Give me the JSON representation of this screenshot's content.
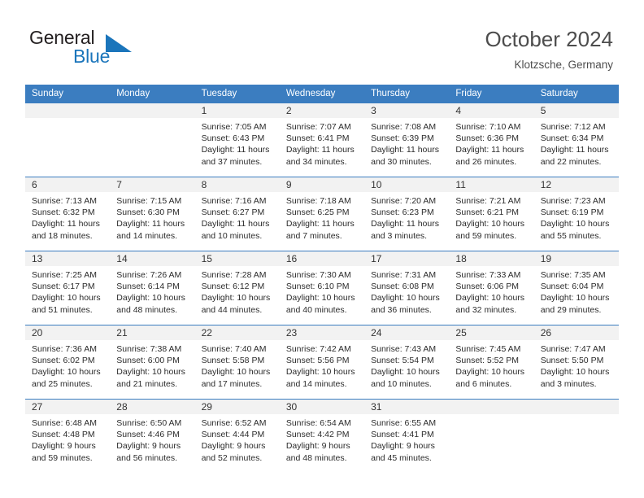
{
  "brand": {
    "name_part1": "General",
    "name_part2": "Blue",
    "flag_icon": "triangle-flag-icon",
    "accent_color": "#1b75bb"
  },
  "header": {
    "title": "October 2024",
    "subtitle": "Klotzsche, Germany"
  },
  "theme": {
    "header_row_color": "#3b7dc0",
    "daynum_band_color": "#f2f2f2",
    "text_color": "#2b2b2b"
  },
  "weekday_headers": [
    "Sunday",
    "Monday",
    "Tuesday",
    "Wednesday",
    "Thursday",
    "Friday",
    "Saturday"
  ],
  "weeks": [
    [
      {
        "day": "",
        "sunrise": "",
        "sunset": "",
        "daylight_line1": "",
        "daylight_line2": ""
      },
      {
        "day": "",
        "sunrise": "",
        "sunset": "",
        "daylight_line1": "",
        "daylight_line2": ""
      },
      {
        "day": "1",
        "sunrise": "Sunrise: 7:05 AM",
        "sunset": "Sunset: 6:43 PM",
        "daylight_line1": "Daylight: 11 hours",
        "daylight_line2": "and 37 minutes."
      },
      {
        "day": "2",
        "sunrise": "Sunrise: 7:07 AM",
        "sunset": "Sunset: 6:41 PM",
        "daylight_line1": "Daylight: 11 hours",
        "daylight_line2": "and 34 minutes."
      },
      {
        "day": "3",
        "sunrise": "Sunrise: 7:08 AM",
        "sunset": "Sunset: 6:39 PM",
        "daylight_line1": "Daylight: 11 hours",
        "daylight_line2": "and 30 minutes."
      },
      {
        "day": "4",
        "sunrise": "Sunrise: 7:10 AM",
        "sunset": "Sunset: 6:36 PM",
        "daylight_line1": "Daylight: 11 hours",
        "daylight_line2": "and 26 minutes."
      },
      {
        "day": "5",
        "sunrise": "Sunrise: 7:12 AM",
        "sunset": "Sunset: 6:34 PM",
        "daylight_line1": "Daylight: 11 hours",
        "daylight_line2": "and 22 minutes."
      }
    ],
    [
      {
        "day": "6",
        "sunrise": "Sunrise: 7:13 AM",
        "sunset": "Sunset: 6:32 PM",
        "daylight_line1": "Daylight: 11 hours",
        "daylight_line2": "and 18 minutes."
      },
      {
        "day": "7",
        "sunrise": "Sunrise: 7:15 AM",
        "sunset": "Sunset: 6:30 PM",
        "daylight_line1": "Daylight: 11 hours",
        "daylight_line2": "and 14 minutes."
      },
      {
        "day": "8",
        "sunrise": "Sunrise: 7:16 AM",
        "sunset": "Sunset: 6:27 PM",
        "daylight_line1": "Daylight: 11 hours",
        "daylight_line2": "and 10 minutes."
      },
      {
        "day": "9",
        "sunrise": "Sunrise: 7:18 AM",
        "sunset": "Sunset: 6:25 PM",
        "daylight_line1": "Daylight: 11 hours",
        "daylight_line2": "and 7 minutes."
      },
      {
        "day": "10",
        "sunrise": "Sunrise: 7:20 AM",
        "sunset": "Sunset: 6:23 PM",
        "daylight_line1": "Daylight: 11 hours",
        "daylight_line2": "and 3 minutes."
      },
      {
        "day": "11",
        "sunrise": "Sunrise: 7:21 AM",
        "sunset": "Sunset: 6:21 PM",
        "daylight_line1": "Daylight: 10 hours",
        "daylight_line2": "and 59 minutes."
      },
      {
        "day": "12",
        "sunrise": "Sunrise: 7:23 AM",
        "sunset": "Sunset: 6:19 PM",
        "daylight_line1": "Daylight: 10 hours",
        "daylight_line2": "and 55 minutes."
      }
    ],
    [
      {
        "day": "13",
        "sunrise": "Sunrise: 7:25 AM",
        "sunset": "Sunset: 6:17 PM",
        "daylight_line1": "Daylight: 10 hours",
        "daylight_line2": "and 51 minutes."
      },
      {
        "day": "14",
        "sunrise": "Sunrise: 7:26 AM",
        "sunset": "Sunset: 6:14 PM",
        "daylight_line1": "Daylight: 10 hours",
        "daylight_line2": "and 48 minutes."
      },
      {
        "day": "15",
        "sunrise": "Sunrise: 7:28 AM",
        "sunset": "Sunset: 6:12 PM",
        "daylight_line1": "Daylight: 10 hours",
        "daylight_line2": "and 44 minutes."
      },
      {
        "day": "16",
        "sunrise": "Sunrise: 7:30 AM",
        "sunset": "Sunset: 6:10 PM",
        "daylight_line1": "Daylight: 10 hours",
        "daylight_line2": "and 40 minutes."
      },
      {
        "day": "17",
        "sunrise": "Sunrise: 7:31 AM",
        "sunset": "Sunset: 6:08 PM",
        "daylight_line1": "Daylight: 10 hours",
        "daylight_line2": "and 36 minutes."
      },
      {
        "day": "18",
        "sunrise": "Sunrise: 7:33 AM",
        "sunset": "Sunset: 6:06 PM",
        "daylight_line1": "Daylight: 10 hours",
        "daylight_line2": "and 32 minutes."
      },
      {
        "day": "19",
        "sunrise": "Sunrise: 7:35 AM",
        "sunset": "Sunset: 6:04 PM",
        "daylight_line1": "Daylight: 10 hours",
        "daylight_line2": "and 29 minutes."
      }
    ],
    [
      {
        "day": "20",
        "sunrise": "Sunrise: 7:36 AM",
        "sunset": "Sunset: 6:02 PM",
        "daylight_line1": "Daylight: 10 hours",
        "daylight_line2": "and 25 minutes."
      },
      {
        "day": "21",
        "sunrise": "Sunrise: 7:38 AM",
        "sunset": "Sunset: 6:00 PM",
        "daylight_line1": "Daylight: 10 hours",
        "daylight_line2": "and 21 minutes."
      },
      {
        "day": "22",
        "sunrise": "Sunrise: 7:40 AM",
        "sunset": "Sunset: 5:58 PM",
        "daylight_line1": "Daylight: 10 hours",
        "daylight_line2": "and 17 minutes."
      },
      {
        "day": "23",
        "sunrise": "Sunrise: 7:42 AM",
        "sunset": "Sunset: 5:56 PM",
        "daylight_line1": "Daylight: 10 hours",
        "daylight_line2": "and 14 minutes."
      },
      {
        "day": "24",
        "sunrise": "Sunrise: 7:43 AM",
        "sunset": "Sunset: 5:54 PM",
        "daylight_line1": "Daylight: 10 hours",
        "daylight_line2": "and 10 minutes."
      },
      {
        "day": "25",
        "sunrise": "Sunrise: 7:45 AM",
        "sunset": "Sunset: 5:52 PM",
        "daylight_line1": "Daylight: 10 hours",
        "daylight_line2": "and 6 minutes."
      },
      {
        "day": "26",
        "sunrise": "Sunrise: 7:47 AM",
        "sunset": "Sunset: 5:50 PM",
        "daylight_line1": "Daylight: 10 hours",
        "daylight_line2": "and 3 minutes."
      }
    ],
    [
      {
        "day": "27",
        "sunrise": "Sunrise: 6:48 AM",
        "sunset": "Sunset: 4:48 PM",
        "daylight_line1": "Daylight: 9 hours",
        "daylight_line2": "and 59 minutes."
      },
      {
        "day": "28",
        "sunrise": "Sunrise: 6:50 AM",
        "sunset": "Sunset: 4:46 PM",
        "daylight_line1": "Daylight: 9 hours",
        "daylight_line2": "and 56 minutes."
      },
      {
        "day": "29",
        "sunrise": "Sunrise: 6:52 AM",
        "sunset": "Sunset: 4:44 PM",
        "daylight_line1": "Daylight: 9 hours",
        "daylight_line2": "and 52 minutes."
      },
      {
        "day": "30",
        "sunrise": "Sunrise: 6:54 AM",
        "sunset": "Sunset: 4:42 PM",
        "daylight_line1": "Daylight: 9 hours",
        "daylight_line2": "and 48 minutes."
      },
      {
        "day": "31",
        "sunrise": "Sunrise: 6:55 AM",
        "sunset": "Sunset: 4:41 PM",
        "daylight_line1": "Daylight: 9 hours",
        "daylight_line2": "and 45 minutes."
      },
      {
        "day": "",
        "sunrise": "",
        "sunset": "",
        "daylight_line1": "",
        "daylight_line2": ""
      },
      {
        "day": "",
        "sunrise": "",
        "sunset": "",
        "daylight_line1": "",
        "daylight_line2": ""
      }
    ]
  ]
}
